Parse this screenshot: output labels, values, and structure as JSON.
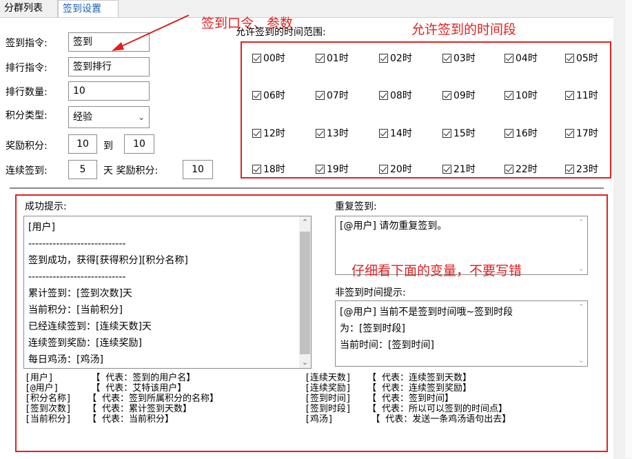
{
  "tabs": [
    "分群列表",
    "签到设置"
  ],
  "form": {
    "signin_cmd_label": "签到指令:",
    "signin_cmd_value": "签到",
    "rank_cmd_label": "排行指令:",
    "rank_cmd_value": "签到排行",
    "rank_count_label": "排行数量:",
    "rank_count_value": "10",
    "points_type_label": "积分类型:",
    "points_type_value": "经验",
    "reward_label": "奖励积分:",
    "reward_min": "10",
    "reward_to": "到",
    "reward_max": "10",
    "streak_label": "连续签到:",
    "streak_days": "5",
    "streak_mid": "天 奖励积分:",
    "streak_reward": "10"
  },
  "time_range": {
    "title": "允许签到的时间范围:",
    "hours": [
      "00时",
      "01时",
      "02时",
      "03时",
      "04时",
      "05时",
      "06时",
      "07时",
      "08时",
      "09时",
      "10时",
      "11时",
      "12时",
      "13时",
      "14时",
      "15时",
      "16时",
      "17时",
      "18时",
      "19时",
      "20时",
      "21时",
      "22时",
      "23时"
    ]
  },
  "annotations": {
    "arrow_note": "签到口令、参数",
    "time_note": "允许签到的时间段",
    "var_note": "仔细看下面的变量，不要写错"
  },
  "success": {
    "label": "成功提示:",
    "lines": [
      "[用户]",
      "----------------------------",
      "签到成功，获得[获得积分][积分名称]",
      "----------------------------",
      "累计签到：[签到次数]天",
      "当前积分：[当前积分]",
      "已经连续签到：[连续天数]天",
      "连续签到奖励：[连续奖励]",
      "每日鸡汤：[鸡汤]"
    ]
  },
  "repeat": {
    "label": "重复签到:",
    "lines": [
      "[@用户] 请勿重复签到。"
    ]
  },
  "nontime": {
    "label": "非签到时间提示:",
    "lines": [
      "[@用户] 当前不是签到时间哦~签到时段",
      "为：[签到时段]",
      "当前时间：[签到时间]"
    ]
  },
  "variables_left": [
    "[用户]       【 代表：签到的用户名】",
    "[@用户]      【 代表：艾特该用户】",
    "[积分名称]   【 代表：签到所属积分的名称】",
    "[签到次数]   【 代表：累计签到天数】",
    "[当前积分]   【 代表：当前积分】"
  ],
  "variables_right": [
    "[连续天数]   【 代表：连续签到天数】",
    "[连续奖励]   【 代表：连续签到奖励】",
    "[签到时间]   【 代表：签到时间】",
    "[签到时段]   【 代表：所以可以签到的时间点】",
    "[鸡汤]       【 代表：发送一条鸡汤语句出去】"
  ],
  "colors": {
    "annotation": "#e02020",
    "active_tab": "#1a5fb4"
  }
}
